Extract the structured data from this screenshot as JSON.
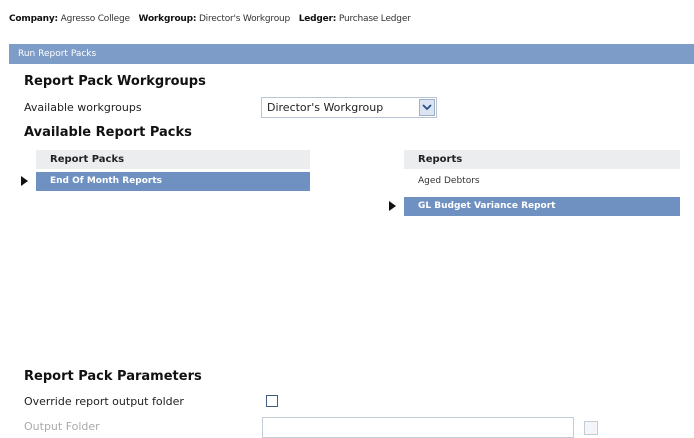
{
  "context": {
    "company_label": "Company:",
    "company_value": "Agresso College",
    "workgroup_label": "Workgroup:",
    "workgroup_value": "Director's Workgroup",
    "ledger_label": "Ledger:",
    "ledger_value": "Purchase Ledger"
  },
  "panel": {
    "title": "Run Report Packs"
  },
  "workgroups": {
    "heading": "Report Pack Workgroups",
    "available_label": "Available workgroups",
    "selected_workgroup": "Director's Workgroup"
  },
  "packs": {
    "heading": "Available Report Packs",
    "list_header": "Report Packs",
    "items": [
      "End Of Month Reports"
    ]
  },
  "reports": {
    "list_header": "Reports",
    "items": [
      "Aged Debtors",
      "GL Budget Variance Report"
    ]
  },
  "parameters": {
    "heading": "Report Pack Parameters",
    "override_label": "Override report output folder",
    "override_checked": false,
    "output_folder_label": "Output Folder",
    "output_folder_value": ""
  },
  "colors": {
    "title_bar": "#7d9cc8",
    "selection": "#6f91c2",
    "list_header_bg": "#ecedee"
  },
  "icons": {
    "selected_row_marker": "triangle-right-icon",
    "dropdown": "chevron-down-icon",
    "browse": "browse-folder-icon"
  }
}
